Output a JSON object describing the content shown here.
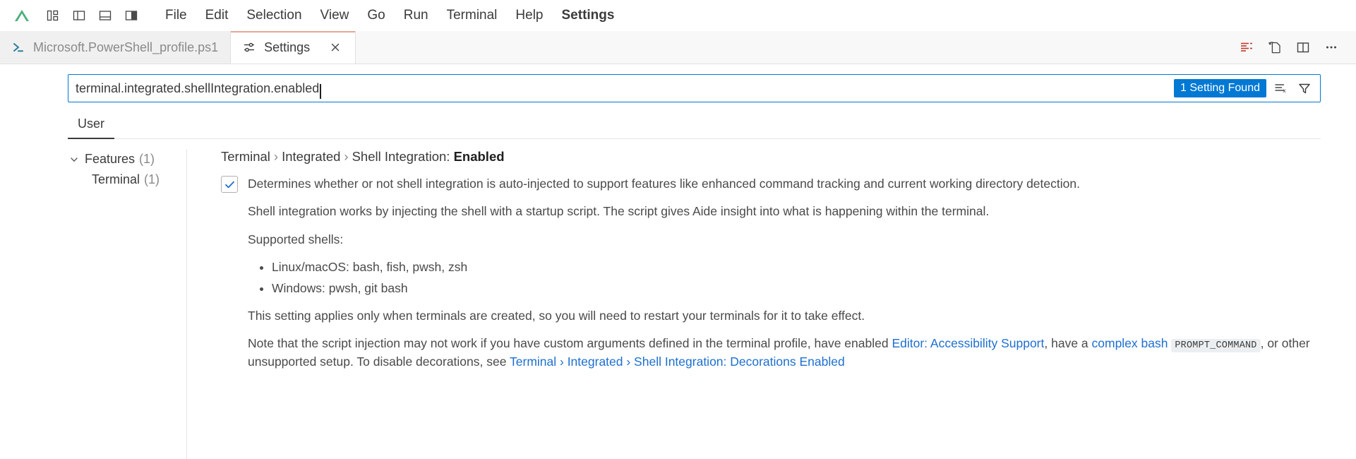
{
  "titlebar": {
    "logo_icon": "aide-logo-icon",
    "logo_color": "#4caf7d",
    "layout_buttons": [
      {
        "icon": "customize-layout-icon",
        "name": "customize-layout"
      },
      {
        "icon": "toggle-primary-sidebar-icon",
        "name": "toggle-primary-sidebar"
      },
      {
        "icon": "toggle-panel-icon",
        "name": "toggle-panel"
      },
      {
        "icon": "toggle-secondary-sidebar-icon",
        "name": "toggle-secondary-sidebar"
      }
    ],
    "menus": [
      {
        "label": "File",
        "bold": false
      },
      {
        "label": "Edit",
        "bold": false
      },
      {
        "label": "Selection",
        "bold": false
      },
      {
        "label": "View",
        "bold": false
      },
      {
        "label": "Go",
        "bold": false
      },
      {
        "label": "Run",
        "bold": false
      },
      {
        "label": "Terminal",
        "bold": false
      },
      {
        "label": "Help",
        "bold": false
      },
      {
        "label": "Settings",
        "bold": true
      }
    ]
  },
  "tabbar": {
    "tabs": [
      {
        "label": "Microsoft.PowerShell_profile.ps1",
        "icon": "powershell-file-icon",
        "active": false,
        "closable": false
      },
      {
        "label": "Settings",
        "icon": "settings-sliders-icon",
        "active": true,
        "closable": true,
        "close_icon": "close-icon"
      }
    ],
    "actions": [
      {
        "name": "split-settings-editor",
        "icon": "open-settings-json-icon"
      },
      {
        "name": "open-changes",
        "icon": "open-changes-icon"
      },
      {
        "name": "split-editor",
        "icon": "split-editor-icon"
      },
      {
        "name": "more-actions",
        "icon": "ellipsis-icon"
      }
    ]
  },
  "search": {
    "value": "terminal.integrated.shellIntegration.enabled",
    "placeholder": "Search settings",
    "results_badge": "1 Setting Found",
    "clear_filters_icon": "clear-filters-icon",
    "filter_icon": "filter-funnel-icon",
    "accent_color": "#0078d4"
  },
  "scope_tabs": [
    {
      "label": "User",
      "active": true
    }
  ],
  "toc": {
    "items": [
      {
        "label": "Features",
        "count": "(1)",
        "expanded": true,
        "child": false
      },
      {
        "label": "Terminal",
        "count": "(1)",
        "expanded": false,
        "child": true
      }
    ]
  },
  "setting": {
    "breadcrumb": {
      "parts": [
        "Terminal",
        "Integrated",
        "Shell Integration: "
      ],
      "part1": "Terminal",
      "part2": "Integrated",
      "part3": "Shell Integration:",
      "leaf": "Enabled",
      "separator": "›"
    },
    "checkbox_checked": true,
    "checkbox_color": "#1f6fd0",
    "paragraphs": {
      "p1": "Determines whether or not shell integration is auto-injected to support features like enhanced command tracking and current working directory detection.",
      "p2": "Shell integration works by injecting the shell with a startup script. The script gives Aide insight into what is happening within the terminal.",
      "p3": "Supported shells:",
      "p4": "This setting applies only when terminals are created, so you will need to restart your terminals for it to take effect."
    },
    "shells": [
      "Linux/macOS: bash, fish, pwsh, zsh",
      "Windows: pwsh, git bash"
    ],
    "note": {
      "text_a": "Note that the script injection may not work if you have custom arguments defined in the terminal profile, have enabled ",
      "link_a": "Editor: Accessibility Support",
      "text_b": ", have a ",
      "link_b": "complex bash",
      "code": "PROMPT_COMMAND",
      "text_c": ", or other unsupported setup. To disable decorations, see ",
      "link_c": "Terminal › Integrated › Shell Integration: Decorations Enabled",
      "link_color": "#1d6fd0"
    }
  }
}
